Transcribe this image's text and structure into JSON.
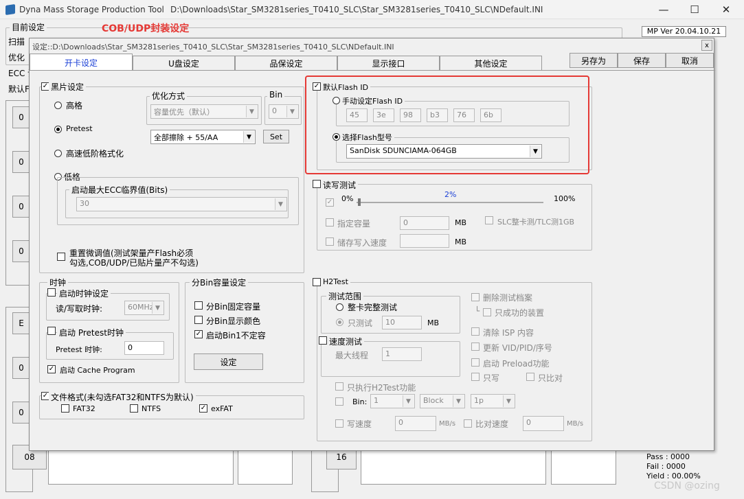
{
  "app": {
    "title": "Dyna Mass Storage Production Tool",
    "path": "D:\\Downloads\\Star_SM3281series_T0410_SLC\\Star_SM3281series_T0410_SLC\\NDefault.INI"
  },
  "bg": {
    "current_settings": "目前设定",
    "cob_label": "COB/UDP封装设定",
    "mp_ver": "MP Ver 20.04.10.21",
    "side_labels": [
      "扫描",
      "优化",
      "ECC 设",
      "默认F"
    ],
    "ports_left": [
      "0",
      "0",
      "0",
      "0",
      "E",
      "0",
      "0",
      "08"
    ],
    "port_16": "16",
    "stats": {
      "pass": "Pass : 0000",
      "fail": "Fail   : 0000",
      "yield": "Yield : 00.00%"
    },
    "watermark": "CSDN @ozing"
  },
  "dialog": {
    "title": "设定::D:\\Downloads\\Star_SM3281series_T0410_SLC\\Star_SM3281series_T0410_SLC\\NDefault.INI",
    "close": "x",
    "tabs": [
      "开卡设定",
      "U盘设定",
      "品保设定",
      "显示接口",
      "其他设定"
    ],
    "actions": [
      "另存为",
      "保存",
      "取消"
    ],
    "chip": {
      "title": "黑片设定",
      "high": "高格",
      "pretest": "Pretest",
      "fast_lowlevel": "高速低阶格式化",
      "low": "低格",
      "ecc_group": "启动最大ECC临界值(Bits)",
      "ecc_value": "30",
      "opt_group": "优化方式",
      "opt_value": "容量优先（默认）",
      "bin_group": "Bin",
      "bin_value": "0",
      "erase_value": "全部擦除 + 55/AA",
      "set": "Set",
      "reset_text1": "重置微调值(测试架量产Flash必须",
      "reset_text2": "勾选,COB/UDP/已贴片量产不勾选)"
    },
    "clock": {
      "title": "时钟",
      "enable": "启动时钟设定",
      "rw_clock": "读/写取时钟:",
      "rw_value": "60MHz",
      "pretest_enable": "启动 Pretest时钟",
      "pretest_clock": "Pretest 时钟:",
      "pretest_value": "0",
      "cache": "启动 Cache Program"
    },
    "bin_cap": {
      "title": "分Bin容量设定",
      "fixed": "分Bin固定容量",
      "color": "分Bin显示颜色",
      "bin1": "启动Bin1不定容",
      "setup": "设定"
    },
    "fs": {
      "title": "文件格式(未勾选FAT32和NTFS为默认)",
      "fat32": "FAT32",
      "ntfs": "NTFS",
      "exfat": "exFAT"
    },
    "flash": {
      "title": "默认Flash ID",
      "manual": "手动设定Flash ID",
      "ids": [
        "45",
        "3e",
        "98",
        "b3",
        "76",
        "6b"
      ],
      "select": "选择Flash型号",
      "model": "SanDisk SDUNCIAMA-064GB"
    },
    "rw": {
      "title": "读写测试",
      "p0": "0%",
      "pct": "2%",
      "p100": "100%",
      "capacity": "指定容量",
      "cap_value": "0",
      "mb": "MB",
      "slc": "SLC整卡测/TLC测1GB",
      "write_speed": "储存写入速度"
    },
    "h2": {
      "title": "H2Test",
      "range": "测试范围",
      "full": "整卡完整测试",
      "only": "只测试",
      "only_value": "10",
      "mb": "MB",
      "speed": "速度测试",
      "threads": "最大线程",
      "threads_value": "1",
      "del_log": "删除测试档案",
      "only_ok": "只成功的装置",
      "clear_isp": "清除 ISP 内容",
      "update_vid": "更新 VID/PID/序号",
      "preload": "启动 Preload功能",
      "write_only": "只写",
      "compare_only": "只比对",
      "h2only": "只执行H2Test功能",
      "bin": "Bin:",
      "bin_value": "1",
      "block": "Block",
      "onep": "1p",
      "wspeed": "写速度",
      "wspeed_value": "0",
      "mbs": "MB/s",
      "cspeed": "比对速度",
      "cspeed_value": "0"
    }
  },
  "colors": {
    "highlight": "#e53935",
    "cob": "#e53935",
    "progress": "#1a3fd6"
  }
}
